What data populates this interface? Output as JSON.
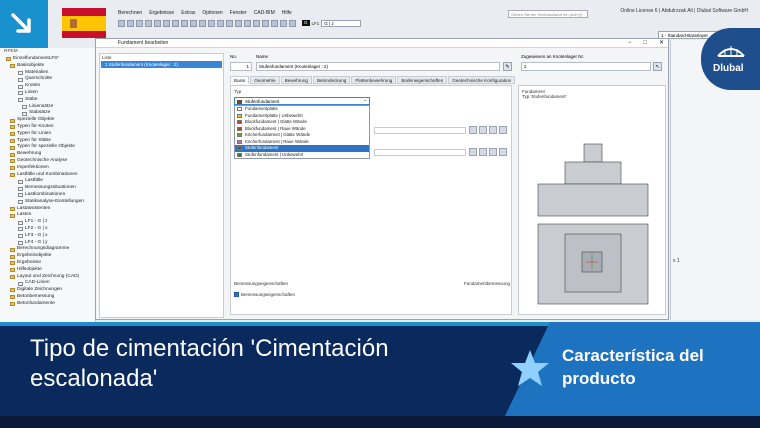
{
  "menu": [
    "Berechnen",
    "Ergebnisse",
    "Extras",
    "Optionen",
    "Fenster",
    "CAD-BIM",
    "Hilfe"
  ],
  "license_info": "Online License 6 | Abdulrzzak Ali | Dlubal Software GmbH",
  "search_placeholder": "Geben Sie ein Schlüsselwort ein (Alt+Q)",
  "loadcase": {
    "tag": "G",
    "id": "LF1",
    "name": "G | z"
  },
  "standard_dropdown": "1 - Standard-Basislayer",
  "navigator": {
    "header": "RFEM",
    "items": [
      "EinzelfundamentLF6*",
      "Basisobjekte",
      "Materialien",
      "Querschnitte",
      "Knoten",
      "Linien",
      "Stäbe",
      "Liniensätze",
      "Stabsätze",
      "Spezielle Objekte",
      "Typen für Knoten",
      "Typen für Linien",
      "Typen für Stäbe",
      "Typen für spezielle Objekte",
      "Bewehrung",
      "Geotechnische Analyse",
      "Imperfektionen",
      "Lastfälle und Kombinationen",
      "Lastfälle",
      "Bemessungssituationen",
      "Lastkombinationen",
      "Statikanalyse-Einstellungen",
      "Lastassistenten",
      "Lasten",
      "LF1 - G | z",
      "LF2 - G | x",
      "LF3 - G | x",
      "LF4 - G | y",
      "Berechnungsdiagramme",
      "Ergebnisobjekte",
      "Ergebnisse",
      "Hilfsobjekte",
      "Layout und Zeichnung (CAD)",
      "CAD-Linien",
      "Digitale Zeichnungen",
      "Betonbemessung",
      "Betonfundamente"
    ]
  },
  "dialog": {
    "title": "Fundament bearbeiten",
    "list_label": "Liste",
    "list_row": "1 Stufenfundament (Knotenlager : 2)",
    "no_label": "No.",
    "no_value": "1",
    "name_label": "Name",
    "name_value": "Stufenfundament (Knotenlager : 2)",
    "assigned_label": "Zugewiesen an Knotenlager Nr.",
    "assigned_value": "2",
    "tabs": [
      "Basis",
      "Geometrie",
      "Bewehrung",
      "Betondeckung",
      "Plattenbewehrung",
      "Bodeneigenschaften",
      "Geotechnische Konfiguration"
    ],
    "typ_label": "Typ",
    "typ_selected": "Stufenfundament",
    "type_options": [
      {
        "label": "Fundamentplatte",
        "color": "#ffffff"
      },
      {
        "label": "Fundamentplatte | Unbewehrt",
        "color": "#e8c23a"
      },
      {
        "label": "Blockfundament | Glatte Wände",
        "color": "#c0392b"
      },
      {
        "label": "Blockfundament | Raue Wände",
        "color": "#8e5a2b"
      },
      {
        "label": "Köcherfundament | Glatte Wände",
        "color": "#7a9a2b"
      },
      {
        "label": "Köcherfundament | Raue Wände",
        "color": "#b07ab8"
      },
      {
        "label": "Stufenfundament",
        "color": "#6a4b2a"
      },
      {
        "label": "Stufenfundament | Unbewehrt",
        "color": "#2e7d32"
      }
    ],
    "selected_index": 6,
    "design_props_label": "Bemessungseigenschaften",
    "design_props_right": "Fundamentbemessung",
    "design_props_check": "Bemessungseigenschaften",
    "preview_caption_1": "Fundament",
    "preview_caption_2": "Typ 'Stufenfundament'"
  },
  "right_panel_text": "x 1",
  "brand": "Dlubal",
  "banner": {
    "title": "Tipo de cimentación 'Cimentación escalonada'",
    "tag": "Característica del producto"
  },
  "colors": {
    "accent": "#1a91cf",
    "banner_bg": "#0a2a5e",
    "tag_bg": "#1e73c0",
    "selection": "#2f74c2"
  }
}
